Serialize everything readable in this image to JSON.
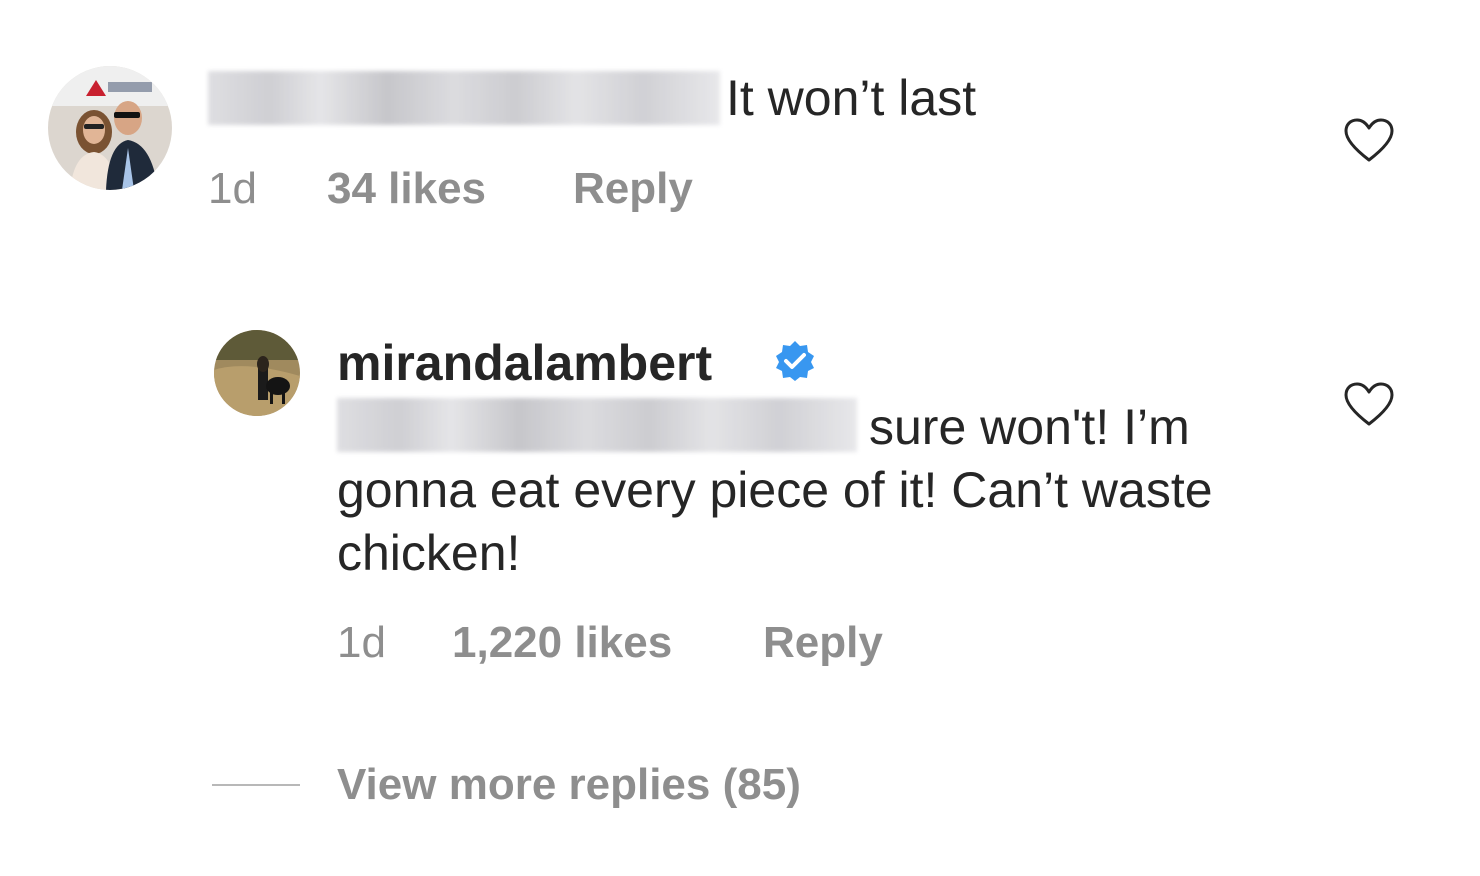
{
  "comment": {
    "text": "It won’t last",
    "time": "1d",
    "likes": "34 likes",
    "reply_label": "Reply",
    "like_icon": "heart-outline-icon"
  },
  "reply": {
    "username": "mirandalambert",
    "verified_icon": "verified-badge-icon",
    "text": "sure won't! I’m gonna eat every piece of it! Can’t waste chicken!",
    "time": "1d",
    "likes": "1,220 likes",
    "reply_label": "Reply",
    "like_icon": "heart-outline-icon"
  },
  "view_more": {
    "label": "View more replies (85)"
  },
  "colors": {
    "text": "#262626",
    "secondary": "#8e8e8e",
    "verified": "#3897f0"
  }
}
